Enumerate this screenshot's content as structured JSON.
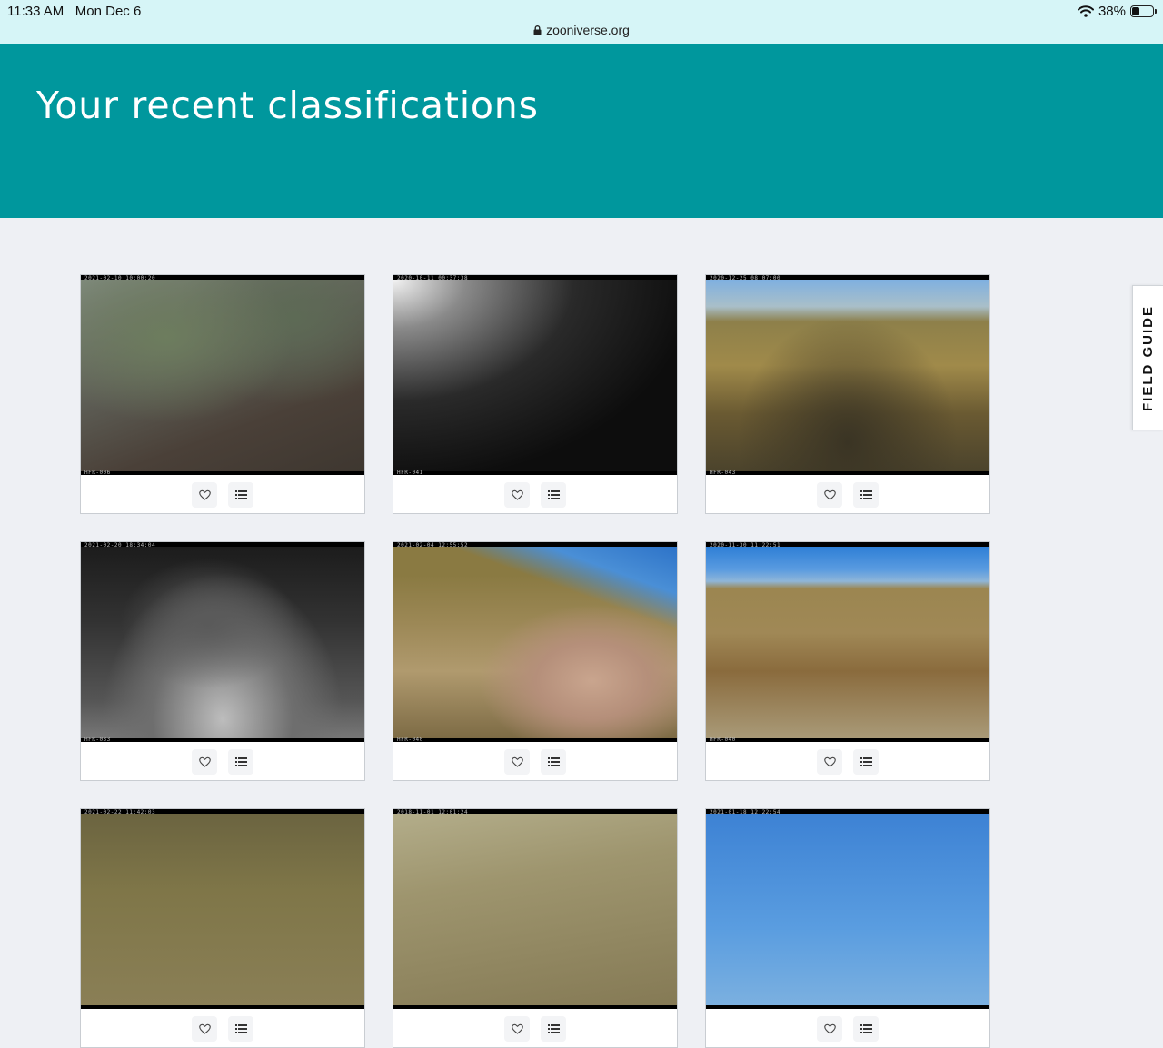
{
  "status_bar": {
    "time": "11:33 AM",
    "date": "Mon Dec 6",
    "url": "zooniverse.org",
    "battery_percent": "38%",
    "battery_level": 0.38
  },
  "header": {
    "title": "Your recent classifications"
  },
  "field_guide": {
    "label": "FIELD GUIDE"
  },
  "icons": {
    "favorite": "heart-icon",
    "collection": "list-icon",
    "lock": "lock-icon",
    "wifi": "wifi-icon",
    "battery": "battery-icon"
  },
  "colors": {
    "banner": "#00979d",
    "status_bar": "#d6f5f7",
    "page_bg": "#eef0f4"
  },
  "classifications": [
    {
      "timestamp": "2021-02-10 10:00:20",
      "camera": "HFR-006"
    },
    {
      "timestamp": "2020-10-11 00:37:38",
      "camera": "HFR-041"
    },
    {
      "timestamp": "2020-12-25 08:07:00",
      "camera": "HFR-043"
    },
    {
      "timestamp": "2021-02-20 18:34:04",
      "camera": "HFR-033"
    },
    {
      "timestamp": "2021-02-04 12:55:52",
      "camera": "HFR-040"
    },
    {
      "timestamp": "2020-11-30 11:22:51",
      "camera": "HFR-040"
    },
    {
      "timestamp": "2021-02-22 11:42:03",
      "camera": ""
    },
    {
      "timestamp": "2018-11-01 12:01:24",
      "camera": ""
    },
    {
      "timestamp": "2021-01-18 12:22:54",
      "camera": ""
    }
  ]
}
